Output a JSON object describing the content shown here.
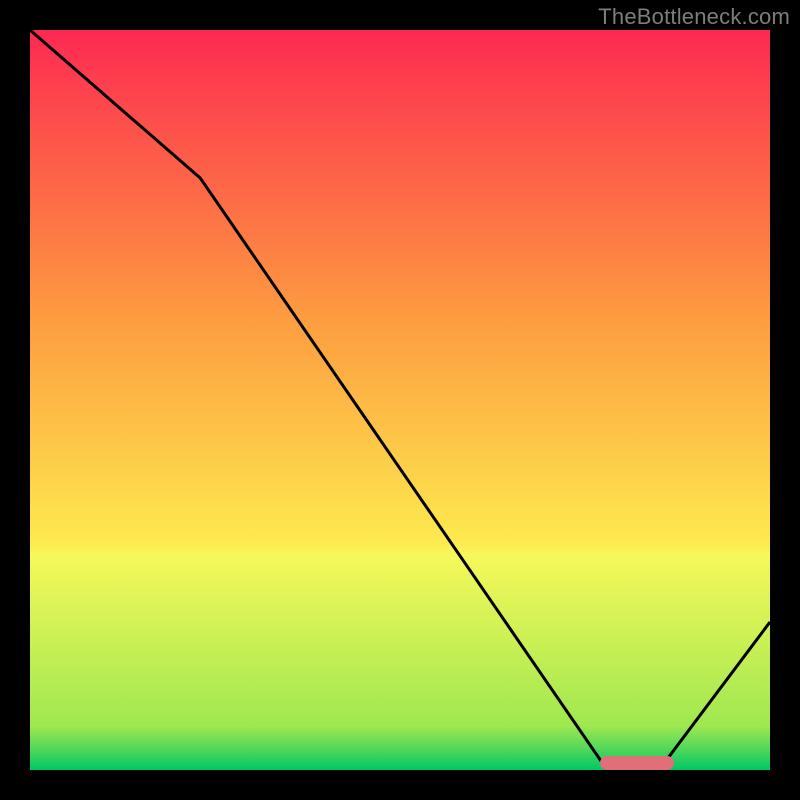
{
  "watermark": "TheBottleneck.com",
  "colors": {
    "gradient_top": "#fd2852",
    "gradient_mid1": "#fd9c40",
    "gradient_mid2": "#fde94e",
    "gradient_bottom": "#00c864",
    "curve": "#000000",
    "marker": "#e07078",
    "frame": "#000000"
  },
  "chart_data": {
    "type": "line",
    "title": "",
    "xlabel": "",
    "ylabel": "",
    "xlim": [
      0,
      100
    ],
    "ylim": [
      0,
      100
    ],
    "grid": false,
    "series": [
      {
        "name": "curve",
        "x": [
          0,
          23,
          78,
          85,
          100
        ],
        "values": [
          100,
          80,
          0,
          0,
          20
        ]
      }
    ],
    "annotations": [
      {
        "kind": "marker-bar",
        "x_start": 77,
        "x_end": 87,
        "y": 1
      }
    ],
    "notes": "Y maps to vertical color gradient: 0≈green(bottom), 100≈red(top). Curve shows bottleneck metric minimized around x≈78–85."
  }
}
